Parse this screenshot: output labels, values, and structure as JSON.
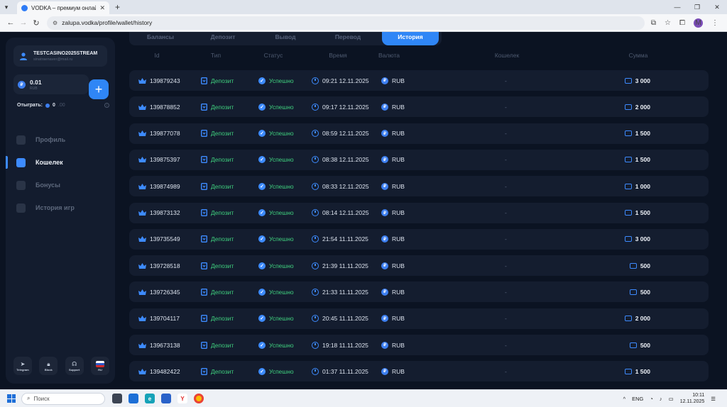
{
  "browser": {
    "tab_title": "VODKA – премиум онлайн-ка",
    "url": "zalupa.vodka/profile/wallet/history",
    "profile_initial": "M"
  },
  "sidebar": {
    "username": "TESTCASINO2025STREAM",
    "email": "sinatraenaver@mail.ru",
    "balance": "0.01",
    "balance_currency": "RUB",
    "wager_label": "Отыграть:",
    "wager_value": "0",
    "wager_value_dim": ".00",
    "menu": [
      {
        "label": "Профиль",
        "icon": "user-icon"
      },
      {
        "label": "Кошелек",
        "icon": "wallet-icon",
        "active": true
      },
      {
        "label": "Бонусы",
        "icon": "gift-icon"
      },
      {
        "label": "История игр",
        "icon": "history-icon"
      }
    ],
    "footer": [
      {
        "label": "Telegram",
        "icon": "telegram-icon"
      },
      {
        "label": "Block",
        "icon": "lock-icon"
      },
      {
        "label": "Support",
        "icon": "support-icon"
      },
      {
        "label": "RU",
        "icon": "russia-flag-icon"
      }
    ]
  },
  "subtabs": [
    "Балансы",
    "Депозит",
    "Вывод",
    "Перевод",
    "История"
  ],
  "table": {
    "headers": {
      "id": "Id",
      "type": "Тип",
      "status": "Статус",
      "time": "Время",
      "currency": "Валюта",
      "wallet": "Кошелек",
      "amount": "Сумма"
    },
    "rows": [
      {
        "id": "139879243",
        "type": "Депозит",
        "status": "Успешно",
        "time": "09:21 12.11.2025",
        "currency": "RUB",
        "wallet": "-",
        "amount": "3 000"
      },
      {
        "id": "139878852",
        "type": "Депозит",
        "status": "Успешно",
        "time": "09:17 12.11.2025",
        "currency": "RUB",
        "wallet": "-",
        "amount": "2 000"
      },
      {
        "id": "139877078",
        "type": "Депозит",
        "status": "Успешно",
        "time": "08:59 12.11.2025",
        "currency": "RUB",
        "wallet": "-",
        "amount": "1 500"
      },
      {
        "id": "139875397",
        "type": "Депозит",
        "status": "Успешно",
        "time": "08:38 12.11.2025",
        "currency": "RUB",
        "wallet": "-",
        "amount": "1 500"
      },
      {
        "id": "139874989",
        "type": "Депозит",
        "status": "Успешно",
        "time": "08:33 12.11.2025",
        "currency": "RUB",
        "wallet": "-",
        "amount": "1 000"
      },
      {
        "id": "139873132",
        "type": "Депозит",
        "status": "Успешно",
        "time": "08:14 12.11.2025",
        "currency": "RUB",
        "wallet": "-",
        "amount": "1 500"
      },
      {
        "id": "139735549",
        "type": "Депозит",
        "status": "Успешно",
        "time": "21:54 11.11.2025",
        "currency": "RUB",
        "wallet": "-",
        "amount": "3 000"
      },
      {
        "id": "139728518",
        "type": "Депозит",
        "status": "Успешно",
        "time": "21:39 11.11.2025",
        "currency": "RUB",
        "wallet": "-",
        "amount": "500"
      },
      {
        "id": "139726345",
        "type": "Депозит",
        "status": "Успешно",
        "time": "21:33 11.11.2025",
        "currency": "RUB",
        "wallet": "-",
        "amount": "500"
      },
      {
        "id": "139704117",
        "type": "Депозит",
        "status": "Успешно",
        "time": "20:45 11.11.2025",
        "currency": "RUB",
        "wallet": "-",
        "amount": "2 000"
      },
      {
        "id": "139673138",
        "type": "Депозит",
        "status": "Успешно",
        "time": "19:18 11.11.2025",
        "currency": "RUB",
        "wallet": "-",
        "amount": "500"
      },
      {
        "id": "139482422",
        "type": "Депозит",
        "status": "Успешно",
        "time": "01:37 11.11.2025",
        "currency": "RUB",
        "wallet": "-",
        "amount": "1 500"
      }
    ]
  },
  "taskbar": {
    "search_placeholder": "Поиск",
    "lang": "ENG",
    "time": "10:11",
    "date": "12.11.2025"
  },
  "colors": {
    "accent": "#2f86f6",
    "success": "#3fd07e",
    "background": "#0b1322",
    "panel": "#141d2f"
  }
}
